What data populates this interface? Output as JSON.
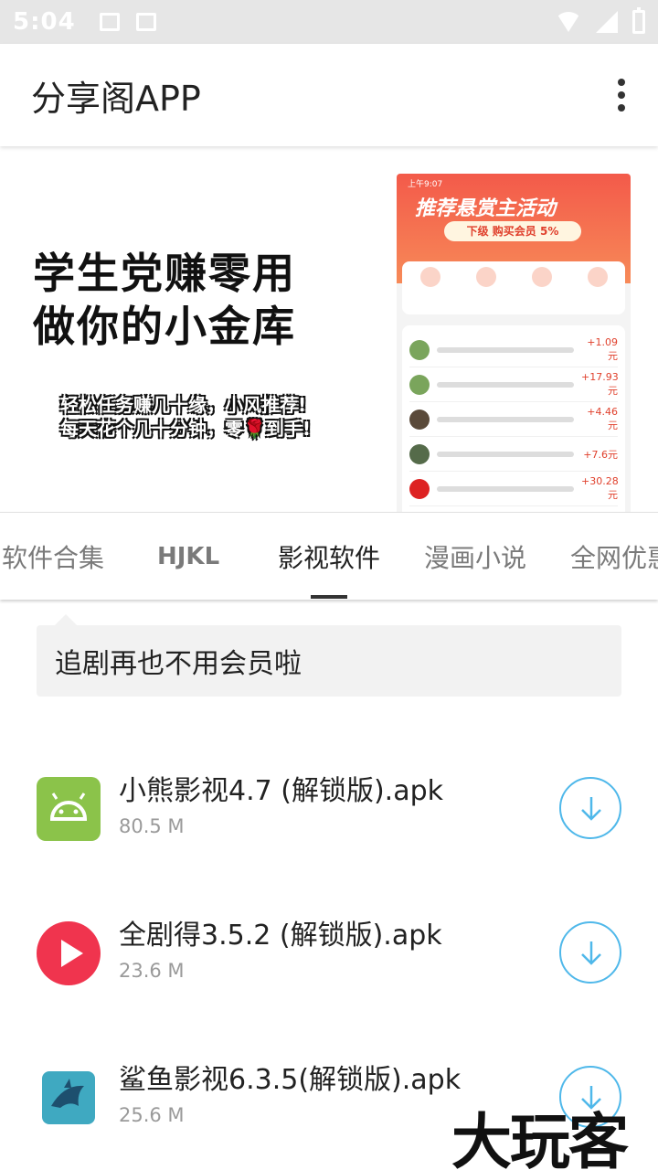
{
  "status_bar": {
    "time": "5:04"
  },
  "app_bar": {
    "title": "分享阁APP"
  },
  "banner": {
    "headline_line1": "学生党赚零用",
    "headline_line2": "做你的小金库",
    "sub_line1": "轻松任务赚几十缘，小风推荐!",
    "sub_line2": "每天花个几十分钟，零🌹到手!",
    "phone_time": "上午9:07",
    "phone_headline": "推荐悬赏主活动",
    "phone_pill": "下级 购买会员 5%",
    "phone_values": [
      "+1.09元",
      "+17.93元",
      "+4.46元",
      "+7.6元",
      "+30.28元"
    ]
  },
  "tabs": [
    {
      "label": "软件合集"
    },
    {
      "label": "HJKL"
    },
    {
      "label": "影视软件"
    },
    {
      "label": "漫画小说"
    },
    {
      "label": "全网优惠"
    }
  ],
  "active_tab": "影视软件",
  "description": "追剧再也不用会员啦",
  "files": [
    {
      "name": "小熊影视4.7 (解锁版).apk",
      "size": "80.5 M",
      "icon": "android-icon"
    },
    {
      "name": "全剧得3.5.2 (解锁版).apk",
      "size": "23.6 M",
      "icon": "play-icon"
    },
    {
      "name": "鲨鱼影视6.3.5(解锁版).apk",
      "size": "25.6 M",
      "icon": "shark-icon"
    }
  ],
  "watermark": "大玩客",
  "colors": {
    "accent": "#4fb8ea",
    "android_green": "#8bc34a",
    "play_red": "#f0344e",
    "shark_teal": "#3fa9c1"
  }
}
